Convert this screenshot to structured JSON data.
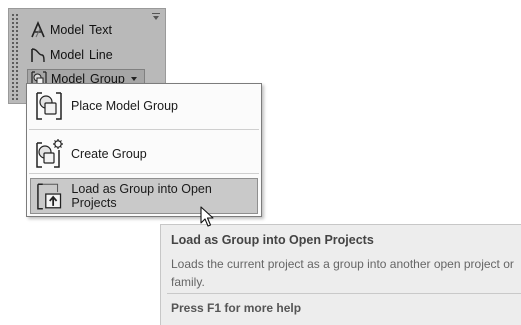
{
  "ribbon_panel": {
    "items": [
      {
        "word1": "Model",
        "word2": "Text",
        "icon": "model-text-icon"
      },
      {
        "word1": "Model",
        "word2": "Line",
        "icon": "model-line-icon"
      },
      {
        "word1": "Model",
        "word2": "Group",
        "icon": "model-group-icon"
      }
    ]
  },
  "dropdown": {
    "items": [
      {
        "label": "Place Model Group",
        "icon": "place-model-group-icon"
      },
      {
        "label": "Create Group",
        "icon": "create-group-icon"
      },
      {
        "label": "Load as Group into Open Projects",
        "icon": "load-group-icon"
      }
    ]
  },
  "tooltip": {
    "title": "Load as Group into Open Projects",
    "description": "Loads the current project as a group into another open project or family.",
    "help": "Press F1 for more help"
  }
}
